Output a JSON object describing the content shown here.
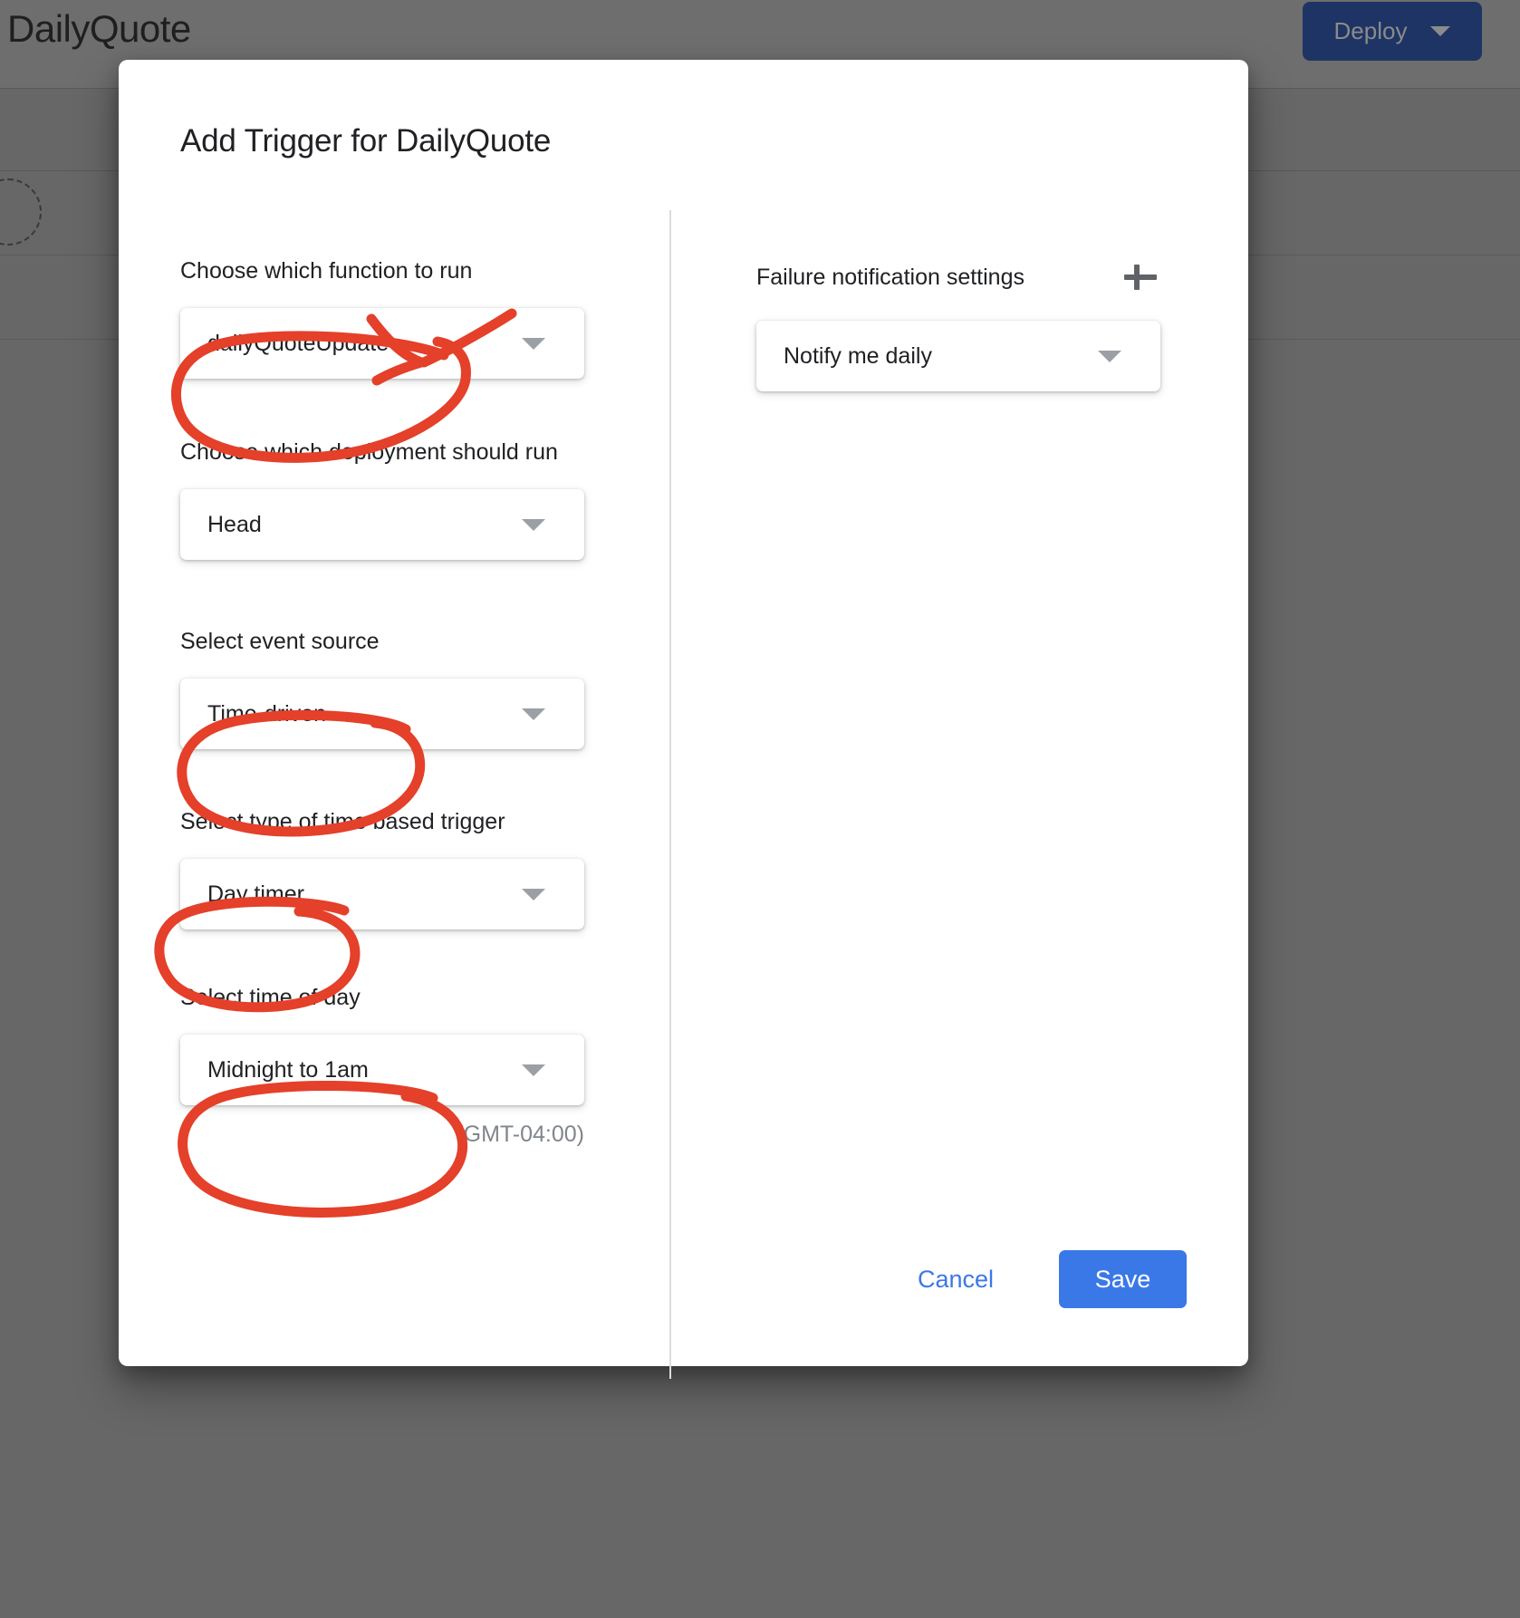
{
  "app": {
    "title": "DailyQuote",
    "deploy_button_label": "Deploy",
    "deploy_caret_icon": "chevron-down-icon"
  },
  "modal": {
    "title": "Add Trigger for DailyQuote",
    "left_column": {
      "fields": [
        {
          "label": "Choose which function to run",
          "value": "dailyQuoteUpdate",
          "caret_icon": "chevron-down-icon",
          "annotated": true
        },
        {
          "label": "Choose which deployment should run",
          "value": "Head",
          "caret_icon": "chevron-down-icon",
          "annotated": false
        },
        {
          "label": "Select event source",
          "value": "Time-driven",
          "caret_icon": "chevron-down-icon",
          "annotated": true
        },
        {
          "label": "Select type of time based trigger",
          "value": "Day timer",
          "caret_icon": "chevron-down-icon",
          "annotated": true
        },
        {
          "label": "Select time of day",
          "value": "Midnight to 1am",
          "caret_icon": "chevron-down-icon",
          "annotated": true
        }
      ],
      "timezone_note": "(GMT-04:00)"
    },
    "right_column": {
      "heading": "Failure notification settings",
      "add_icon": "plus-icon",
      "notification": {
        "value": "Notify me daily",
        "caret_icon": "chevron-down-icon"
      }
    },
    "footer": {
      "cancel_label": "Cancel",
      "save_label": "Save"
    }
  },
  "colors": {
    "annotation_red": "#E4402A",
    "save_blue": "#3b78e7",
    "deploy_navy": "#1e3464",
    "backdrop": "#676767"
  }
}
